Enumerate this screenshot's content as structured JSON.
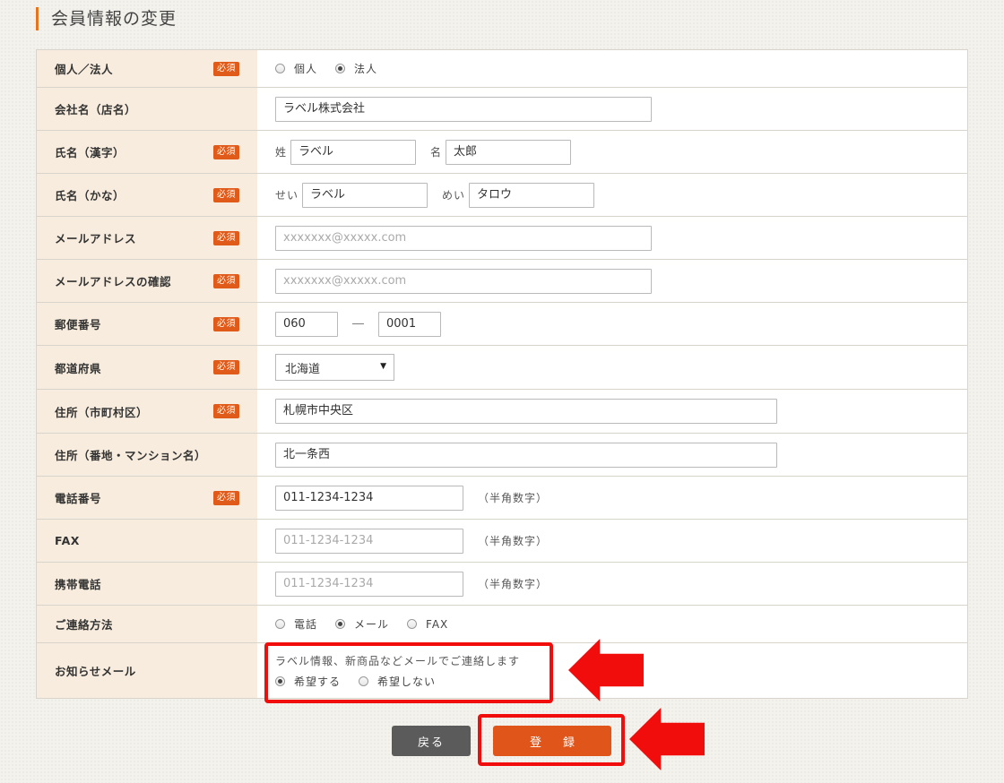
{
  "page_title": "会員情報の変更",
  "required_badge": "必須",
  "rows": {
    "type": {
      "label": "個人／法人",
      "options": [
        {
          "label": "個人",
          "checked": false
        },
        {
          "label": "法人",
          "checked": true
        }
      ]
    },
    "company": {
      "label": "会社名（店名）",
      "value": "ラベル株式会社"
    },
    "name_kanji": {
      "label": "氏名（漢字）",
      "last_prefix": "姓",
      "last_value": "ラベル",
      "first_prefix": "名",
      "first_value": "太郎"
    },
    "name_kana": {
      "label": "氏名（かな）",
      "last_prefix": "せい",
      "last_value": "ラベル",
      "first_prefix": "めい",
      "first_value": "タロウ"
    },
    "email": {
      "label": "メールアドレス",
      "placeholder": "xxxxxxx@xxxxx.com"
    },
    "email_confirm": {
      "label": "メールアドレスの確認",
      "placeholder": "xxxxxxx@xxxxx.com"
    },
    "postal": {
      "label": "郵便番号",
      "part1": "060",
      "separator": "―",
      "part2": "0001"
    },
    "prefecture": {
      "label": "都道府県",
      "selected": "北海道",
      "arrow": "▼"
    },
    "address_city": {
      "label": "住所（市町村区）",
      "value": "札幌市中央区"
    },
    "address_street": {
      "label": "住所（番地・マンション名）",
      "value": "北一条西"
    },
    "phone": {
      "label": "電話番号",
      "value": "011-1234-1234",
      "hint": "（半角数字）"
    },
    "fax": {
      "label": "FAX",
      "placeholder": "011-1234-1234",
      "hint": "（半角数字）"
    },
    "mobile": {
      "label": "携帯電話",
      "placeholder": "011-1234-1234",
      "hint": "（半角数字）"
    },
    "contact_method": {
      "label": "ご連絡方法",
      "options": [
        {
          "label": "電話",
          "checked": false
        },
        {
          "label": "メール",
          "checked": true
        },
        {
          "label": "FAX",
          "checked": false
        }
      ]
    },
    "newsletter": {
      "label": "お知らせメール",
      "description": "ラベル情報、新商品などメールでご連絡します",
      "options": [
        {
          "label": "希望する",
          "checked": true
        },
        {
          "label": "希望しない",
          "checked": false
        }
      ]
    }
  },
  "buttons": {
    "back": "戻る",
    "submit": "登録"
  },
  "colors": {
    "accent": "#e0561a",
    "highlight": "#f20d0d",
    "label_bg": "#f7ecdd"
  }
}
